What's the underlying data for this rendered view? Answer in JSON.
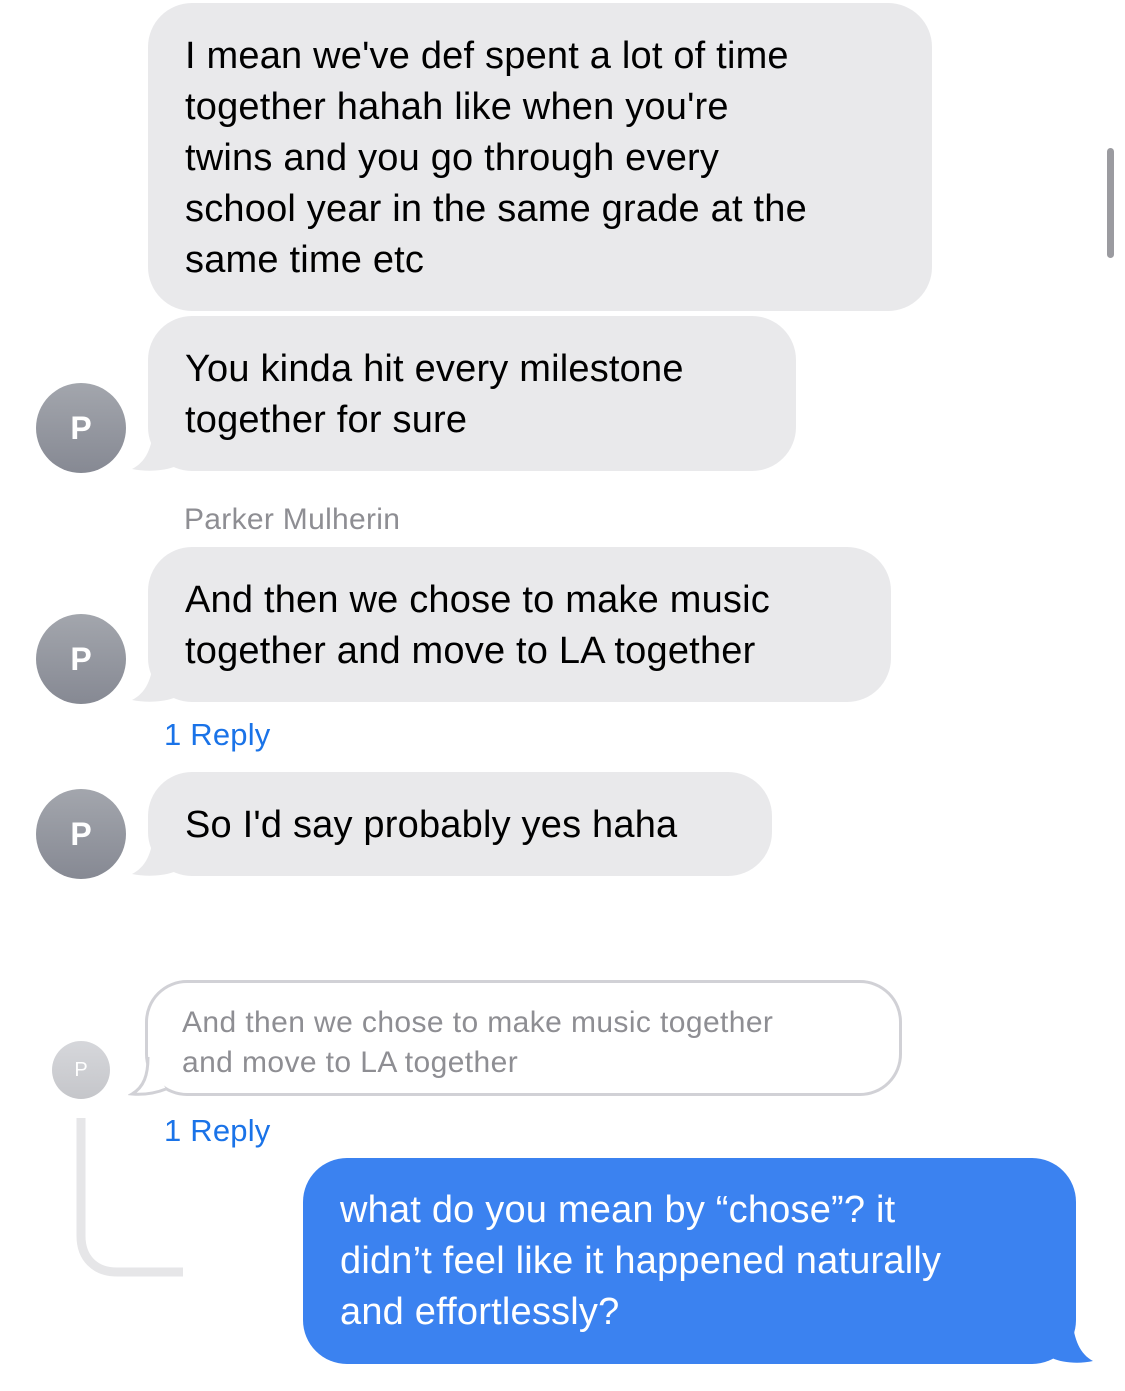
{
  "colors": {
    "incoming_bubble": "#e9e9eb",
    "outgoing_bubble": "#3b82f0",
    "reply_link": "#1a73e8",
    "secondary_text": "#8e8e93"
  },
  "messages": [
    {
      "text": "I mean we've def spent a lot of time\ntogether hahah like when you're\ntwins and you go through every\nschool year in the same grade at the\nsame time etc"
    },
    {
      "text": "You kinda hit every milestone\ntogether for sure",
      "avatar": "P"
    },
    {
      "sender": "Parker Mulherin",
      "text": "And then we chose to make music\ntogether and move to LA together",
      "avatar": "P",
      "replies": "1 Reply"
    },
    {
      "text": "So I'd say probably yes haha",
      "avatar": "P"
    }
  ],
  "thread": {
    "avatar": "P",
    "quoted_text": "And then we chose to make music together\nand move to LA together",
    "replies": "1 Reply",
    "reply": {
      "text": "what do you mean by “chose”? it\ndidn’t feel like it happened naturally\nand effortlessly?"
    }
  },
  "icons": {
    "scrollbar": "scroll-indicator",
    "thread": "thread-connector-line"
  }
}
